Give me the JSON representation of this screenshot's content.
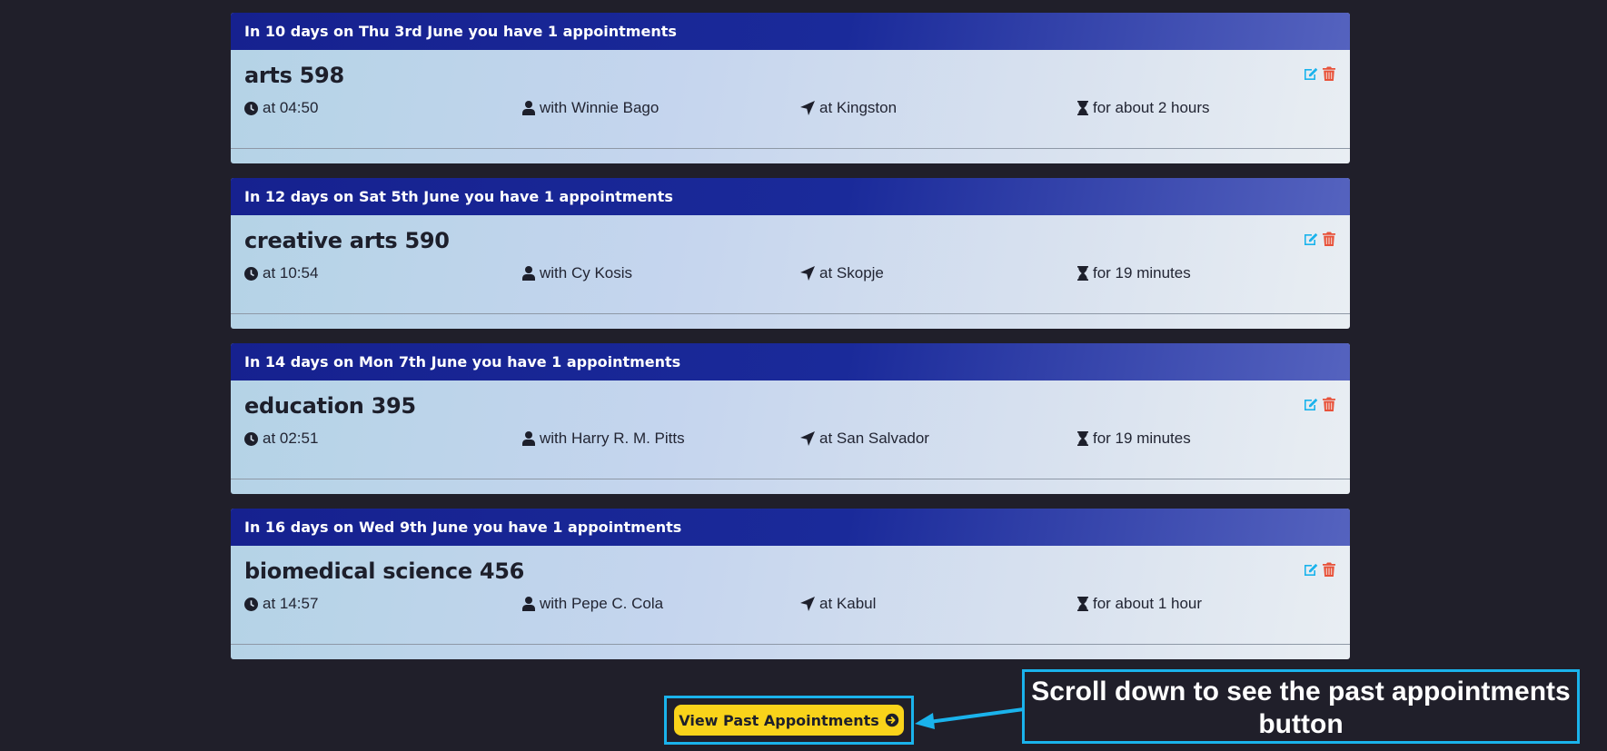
{
  "days": [
    {
      "header": "In 10 days on Thu 3rd June you have 1 appointments",
      "appointments": [
        {
          "title": "arts 598",
          "time": "at 04:50",
          "with": "with Winnie Bago",
          "location": "at Kingston",
          "duration": "for about 2 hours"
        }
      ]
    },
    {
      "header": "In 12 days on Sat 5th June you have 1 appointments",
      "appointments": [
        {
          "title": "creative arts 590",
          "time": "at 10:54",
          "with": "with Cy Kosis",
          "location": "at Skopje",
          "duration": "for 19 minutes"
        }
      ]
    },
    {
      "header": "In 14 days on Mon 7th June you have 1 appointments",
      "appointments": [
        {
          "title": "education 395",
          "time": "at 02:51",
          "with": "with Harry R. M. Pitts",
          "location": "at San Salvador",
          "duration": "for 19 minutes"
        }
      ]
    },
    {
      "header": "In 16 days on Wed 9th June you have 1 appointments",
      "appointments": [
        {
          "title": "biomedical science 456",
          "time": "at 14:57",
          "with": "with Pepe C. Cola",
          "location": "at Kabul",
          "duration": "for about 1 hour"
        }
      ]
    }
  ],
  "past_button": {
    "label": "View Past Appointments",
    "icon": "arrow-circle-right-icon"
  },
  "callout": {
    "text": "Scroll down to see the past appointments button"
  },
  "icons": {
    "time": "clock-icon",
    "with": "user-icon",
    "location": "location-arrow-icon",
    "duration": "hourglass-icon",
    "edit": "edit-icon",
    "delete": "trash-icon"
  },
  "colors": {
    "background": "#201f2a",
    "header": "#16218f",
    "edit": "#1ab3ec",
    "delete": "#e8523a",
    "button": "#f9d31a",
    "highlight": "#1ab3ec"
  }
}
